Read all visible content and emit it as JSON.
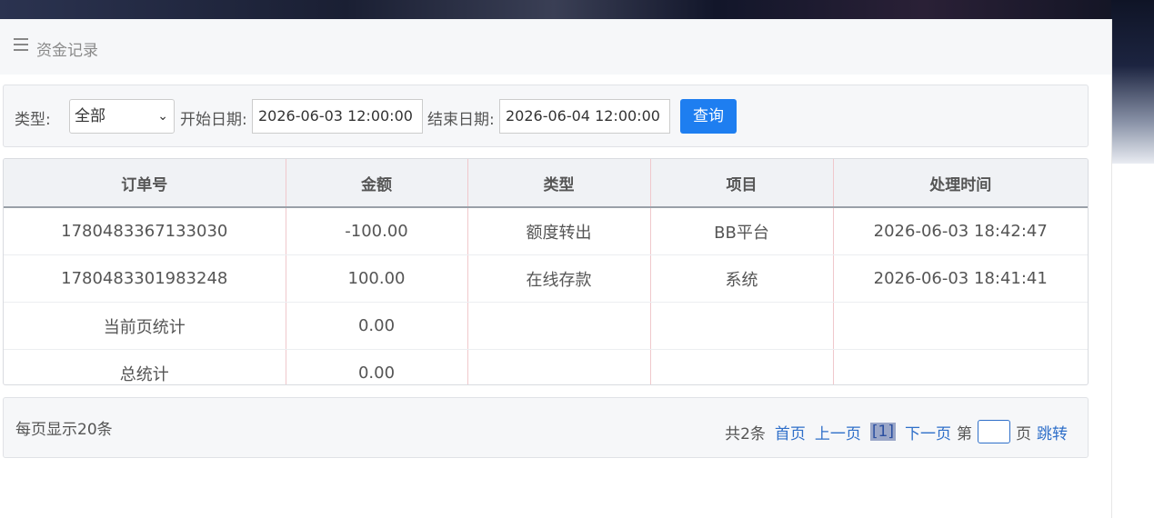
{
  "header": {
    "title": "资金记录"
  },
  "filter": {
    "type_label": "类型:",
    "type_value": "全部",
    "start_label": "开始日期:",
    "start_value": "2026-06-03 12:00:00",
    "end_label": "结束日期:",
    "end_value": "2026-06-04 12:00:00",
    "query_label": "查询"
  },
  "table": {
    "columns": [
      "订单号",
      "金额",
      "类型",
      "项目",
      "处理时间"
    ],
    "rows": [
      [
        "1780483367133030",
        "-100.00",
        "额度转出",
        "BB平台",
        "2026-06-03 18:42:47"
      ],
      [
        "1780483301983248",
        "100.00",
        "在线存款",
        "系统",
        "2026-06-03 18:41:41"
      ]
    ],
    "summary": [
      [
        "当前页统计",
        "0.00",
        "",
        "",
        ""
      ],
      [
        "总统计",
        "0.00",
        "",
        "",
        ""
      ]
    ]
  },
  "pager": {
    "per_page": "每页显示20条",
    "total": "共2条",
    "first": "首页",
    "prev": "上一页",
    "current": "[1]",
    "next": "下一页",
    "goto_prefix": "第",
    "goto_suffix": "页",
    "goto_button": "跳转"
  },
  "icons": {
    "menu": "menu-icon",
    "select_arrow": "chevron-down-icon"
  }
}
